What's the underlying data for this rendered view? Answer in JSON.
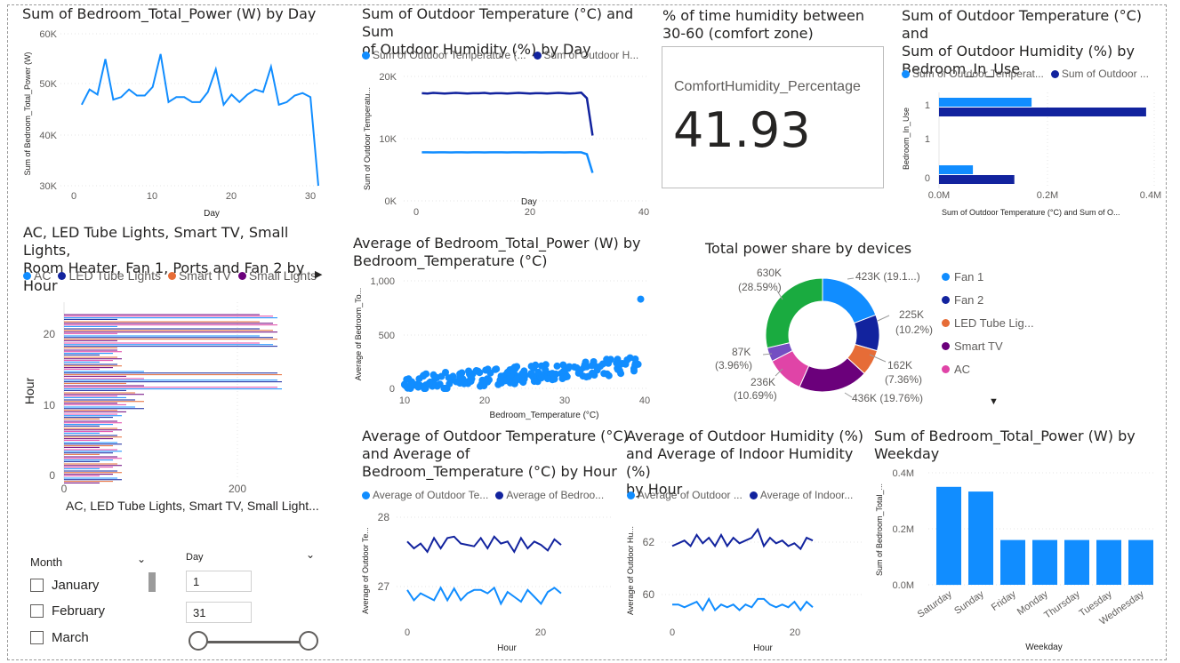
{
  "colors": {
    "light_blue": "#118DFF",
    "dark_blue": "#12239E",
    "orange": "#E66C37",
    "purple": "#6B007B",
    "pink": "#E044A7",
    "green": "#1AAB40",
    "dark_purple": "#744EC2"
  },
  "v1": {
    "title": "Sum of Bedroom_Total_Power (W) by Day",
    "ylabel": "Sum of Bedroom_Total_Power (W)",
    "xlabel": "Day",
    "yticks": [
      "60K",
      "50K",
      "40K",
      "30K"
    ],
    "xticks": [
      "0",
      "10",
      "20",
      "30"
    ]
  },
  "v2": {
    "title_line1": "Sum of Outdoor Temperature (°C) and Sum",
    "title_line2": "of Outdoor Humidity (%) by Day",
    "legend": [
      "Sum of Outdoor Temperature (...",
      "Sum of Outdoor H..."
    ],
    "ylabel": "Sum of Outdoor Temperatu...",
    "xlabel": "Day",
    "yticks": [
      "20K",
      "10K",
      "0K"
    ],
    "xticks": [
      "0",
      "20",
      "40"
    ]
  },
  "card": {
    "title_line1": "% of time humidity between",
    "title_line2": "30-60 (comfort zone)",
    "label": "ComfortHumidity_Percentage",
    "value": "41.93"
  },
  "v4": {
    "title_line1": "Sum of Outdoor Temperature (°C) and",
    "title_line2": "Sum of Outdoor Humidity (%) by",
    "title_line3": "Bedroom_In_Use",
    "legend": [
      "Sum of Outdoor Temperat...",
      "Sum of Outdoor ..."
    ],
    "ylabel": "Bedroom_In_Use",
    "xlabel": "Sum of Outdoor Temperature (°C) and Sum of O...",
    "yticks": [
      "1",
      "1",
      "0"
    ],
    "xticks": [
      "0.0M",
      "0.2M",
      "0.4M"
    ]
  },
  "v5": {
    "title_line1": "AC, LED Tube Lights, Smart TV, Small Lights,",
    "title_line2": "Room Heater, Fan 1, Ports and Fan 2 by Hour",
    "legend": [
      "AC",
      "LED Tube Lights",
      "Smart TV",
      "Small Lights"
    ],
    "ylabel": "Hour",
    "xlabel": "AC, LED Tube Lights, Smart TV, Small Light...",
    "yticks": [
      "20",
      "10",
      "0"
    ],
    "xticks": [
      "0",
      "200"
    ]
  },
  "v6": {
    "title_line1": "Average of Bedroom_Total_Power (W) by",
    "title_line2": "Bedroom_Temperature (°C)",
    "ylabel": "Average of Bedroom_To...",
    "xlabel": "Bedroom_Temperature (°C)",
    "yticks": [
      "1,000",
      "500",
      "0"
    ],
    "xticks": [
      "10",
      "20",
      "30",
      "40"
    ]
  },
  "v7": {
    "title": "Total power share by devices",
    "legend": [
      "Fan 1",
      "Fan 2",
      "LED Tube Lig...",
      "Smart TV",
      "AC"
    ],
    "labels": [
      [
        "423K (19.1...)"
      ],
      [
        "225K",
        "(10.2%)"
      ],
      [
        "162K",
        "(7.36%)"
      ],
      [
        "436K (19.76%)"
      ],
      [
        "236K",
        "(10.69%)"
      ],
      [
        "87K",
        "(3.96%)"
      ],
      [
        "630K",
        "(28.59%)"
      ]
    ]
  },
  "v8": {
    "title_line1": "Average of Outdoor Temperature (°C)",
    "title_line2": "and Average of",
    "title_line3": "Bedroom_Temperature (°C) by Hour",
    "legend": [
      "Average of Outdoor Te...",
      "Average of Bedroo..."
    ],
    "ylabel": "Average of Outdoor Te...",
    "xlabel": "Hour",
    "yticks": [
      "28",
      "27"
    ],
    "xticks": [
      "0",
      "20"
    ]
  },
  "v9": {
    "title_line1": "Average of Outdoor Humidity (%)",
    "title_line2": "and Average of Indoor Humidity (%)",
    "title_line3": "by Hour",
    "legend": [
      "Average of Outdoor ...",
      "Average of Indoor..."
    ],
    "ylabel": "Average of Outdoor Hu...",
    "xlabel": "Hour",
    "yticks": [
      "62",
      "60"
    ],
    "xticks": [
      "0",
      "20"
    ]
  },
  "v10": {
    "title_line1": "Sum of Bedroom_Total_Power (W) by",
    "title_line2": "Weekday",
    "ylabel": "Sum of Bedroom_Total_...",
    "xlabel": "Weekday",
    "yticks": [
      "0.4M",
      "0.2M",
      "0.0M"
    ]
  },
  "slicers": {
    "month_title": "Month",
    "months": [
      "January",
      "February",
      "March"
    ],
    "day_title": "Day",
    "day_min": "1",
    "day_max": "31"
  },
  "chart_data": [
    {
      "type": "line",
      "title": "Sum of Bedroom_Total_Power (W) by Day",
      "xlabel": "Day",
      "ylabel": "Sum of Bedroom_Total_Power (W)",
      "ylim": [
        30000,
        60000
      ],
      "x": [
        1,
        2,
        3,
        4,
        5,
        6,
        7,
        8,
        9,
        10,
        11,
        12,
        13,
        14,
        15,
        16,
        17,
        18,
        19,
        20,
        21,
        22,
        23,
        24,
        25,
        26,
        27,
        28,
        29,
        30,
        31
      ],
      "series": [
        {
          "values": [
            46000,
            49000,
            48000,
            55000,
            47000,
            47500,
            49000,
            47800,
            47800,
            49500,
            56000,
            46500,
            47500,
            47500,
            46500,
            46500,
            48500,
            53000,
            46000,
            48000,
            46500,
            48000,
            49000,
            48500,
            53500,
            46000,
            46500,
            47800,
            48300,
            47500,
            30000
          ]
        }
      ]
    },
    {
      "type": "line",
      "title": "Sum of Outdoor Temperature (°C) and Sum of Outdoor Humidity (%) by Day",
      "xlabel": "Day",
      "ylim": [
        0,
        20000
      ],
      "x": [
        1,
        2,
        3,
        4,
        5,
        6,
        7,
        8,
        9,
        10,
        11,
        12,
        13,
        14,
        15,
        16,
        17,
        18,
        19,
        20,
        21,
        22,
        23,
        24,
        25,
        26,
        27,
        28,
        29,
        30,
        31
      ],
      "series": [
        {
          "name": "Sum of Outdoor Temperature (...",
          "values": [
            7800,
            7800,
            7790,
            7800,
            7800,
            7790,
            7800,
            7800,
            7790,
            7800,
            7800,
            7790,
            7800,
            7800,
            7800,
            7790,
            7800,
            7800,
            7790,
            7800,
            7800,
            7790,
            7800,
            7800,
            7800,
            7790,
            7800,
            7800,
            7800,
            7500,
            4500
          ]
        },
        {
          "name": "Sum of Outdoor H...",
          "values": [
            17300,
            17250,
            17350,
            17300,
            17250,
            17300,
            17350,
            17300,
            17250,
            17300,
            17300,
            17350,
            17250,
            17300,
            17300,
            17250,
            17300,
            17350,
            17300,
            17250,
            17300,
            17300,
            17250,
            17300,
            17350,
            17300,
            17250,
            17300,
            17400,
            16500,
            10500
          ]
        }
      ]
    },
    {
      "type": "bar",
      "title": "Sum of Outdoor Temperature (°C) and Sum of Outdoor Humidity (%) by Bedroom_In_Use",
      "categories": [
        "1",
        "0"
      ],
      "xlim": [
        0,
        400000
      ],
      "series": [
        {
          "name": "Sum of Outdoor Temperat...",
          "values": [
            172000,
            63000
          ]
        },
        {
          "name": "Sum of Outdoor ...",
          "values": [
            385000,
            140000
          ]
        }
      ]
    },
    {
      "type": "scatter",
      "title": "Average of Bedroom_Total_Power (W) by Bedroom_Temperature (°C)",
      "xlabel": "Bedroom_Temperature (°C)",
      "xlim": [
        10,
        40
      ],
      "ylim": [
        0,
        1000
      ]
    },
    {
      "type": "pie",
      "title": "Total power share by devices",
      "slices": [
        {
          "label": "423K (19.1...)",
          "value": 423000,
          "percent": 19.1
        },
        {
          "label": "225K (10.2%)",
          "value": 225000,
          "percent": 10.2
        },
        {
          "label": "162K (7.36%)",
          "value": 162000,
          "percent": 7.36
        },
        {
          "label": "436K (19.76%)",
          "value": 436000,
          "percent": 19.76
        },
        {
          "label": "236K (10.69%)",
          "value": 236000,
          "percent": 10.69
        },
        {
          "label": "87K (3.96%)",
          "value": 87000,
          "percent": 3.96
        },
        {
          "label": "630K (28.59%)",
          "value": 630000,
          "percent": 28.59
        }
      ]
    },
    {
      "type": "line",
      "title": "Average of Outdoor Temperature (°C) and Average of Bedroom_Temperature (°C) by Hour",
      "xlabel": "Hour",
      "ylim": [
        26.6,
        28
      ],
      "x": [
        0,
        1,
        2,
        3,
        4,
        5,
        6,
        7,
        8,
        9,
        10,
        11,
        12,
        13,
        14,
        15,
        16,
        17,
        18,
        19,
        20,
        21,
        22,
        23
      ],
      "series": [
        {
          "name": "Average of Outdoor Te...",
          "values": [
            26.95,
            26.8,
            26.9,
            26.85,
            26.8,
            26.98,
            26.8,
            26.97,
            26.8,
            26.9,
            26.95,
            26.95,
            26.9,
            26.98,
            26.75,
            26.92,
            26.85,
            26.78,
            26.95,
            26.85,
            26.75,
            26.92,
            26.98,
            26.9
          ]
        },
        {
          "name": "Average of Bedroo...",
          "values": [
            27.65,
            27.55,
            27.62,
            27.5,
            27.7,
            27.55,
            27.7,
            27.72,
            27.62,
            27.6,
            27.58,
            27.7,
            27.55,
            27.72,
            27.62,
            27.65,
            27.5,
            27.7,
            27.55,
            27.65,
            27.6,
            27.52,
            27.68,
            27.6
          ]
        }
      ]
    },
    {
      "type": "line",
      "title": "Average of Outdoor Humidity (%) and Average of Indoor Humidity (%) by Hour",
      "xlabel": "Hour",
      "ylim": [
        59.2,
        63
      ],
      "x": [
        0,
        1,
        2,
        3,
        4,
        5,
        6,
        7,
        8,
        9,
        10,
        11,
        12,
        13,
        14,
        15,
        16,
        17,
        18,
        19,
        20,
        21,
        22,
        23
      ],
      "series": [
        {
          "name": "Average of Outdoor ...",
          "values": [
            59.8,
            59.8,
            59.7,
            59.8,
            59.9,
            59.6,
            60.0,
            59.6,
            59.8,
            59.7,
            59.8,
            59.6,
            59.8,
            59.7,
            60.0,
            60.0,
            59.8,
            59.7,
            59.8,
            59.7,
            59.9,
            59.6,
            59.9,
            59.7
          ]
        },
        {
          "name": "Average of Indoor...",
          "values": [
            61.9,
            62.0,
            62.1,
            61.9,
            62.3,
            62.0,
            62.2,
            61.9,
            62.3,
            61.9,
            62.2,
            62.0,
            62.1,
            62.2,
            62.5,
            61.9,
            62.2,
            62.0,
            62.1,
            61.9,
            62.0,
            61.8,
            62.2,
            62.1
          ]
        }
      ]
    },
    {
      "type": "bar",
      "title": "Sum of Bedroom_Total_Power (W) by Weekday",
      "xlabel": "Weekday",
      "ylabel": "Sum of Bedroom_Total_...",
      "ylim": [
        0,
        400000
      ],
      "categories": [
        "Saturday",
        "Sunday",
        "Friday",
        "Monday",
        "Thursday",
        "Tuesday",
        "Wednesday"
      ],
      "values": [
        350000,
        333000,
        160000,
        160000,
        160000,
        160000,
        160000
      ]
    }
  ]
}
